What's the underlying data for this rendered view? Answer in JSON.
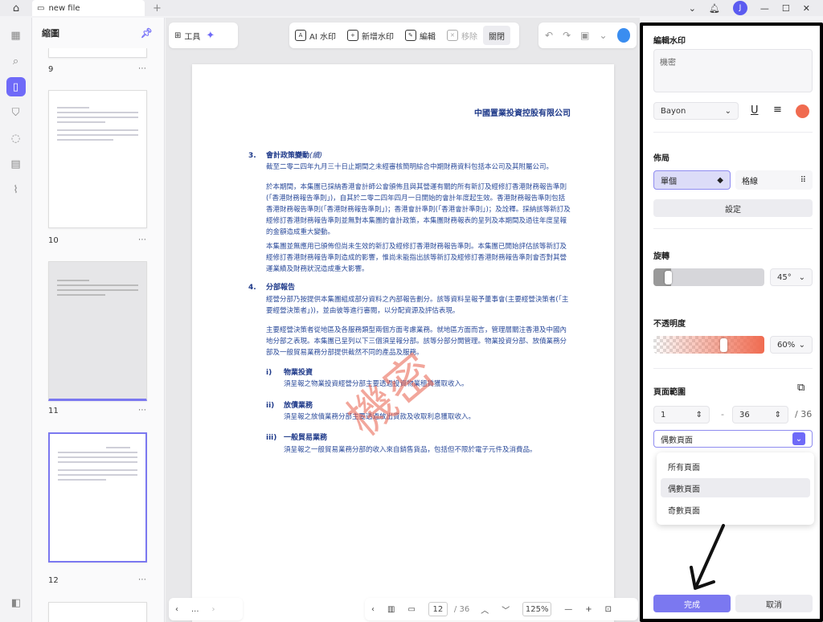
{
  "tab": {
    "title": "new file"
  },
  "left_panel": {
    "title": "縮圖"
  },
  "thumbnails": [
    {
      "number": "9",
      "top": 0
    },
    {
      "number": "10"
    },
    {
      "number": "11"
    },
    {
      "number": "12"
    }
  ],
  "toolbar": {
    "tools_label": "工具",
    "ai_watermark": "AI 水印",
    "add_watermark": "新增水印",
    "edit": "編輯",
    "remove": "移除",
    "close": "關閉"
  },
  "document": {
    "company": "中國置業投資控股有限公司",
    "section3_num": "3.",
    "section3_title": "會計政策變動",
    "section3_title_suffix": "(續)",
    "p1": "截至二零二四年九月三十日止期間之未經審核簡明綜合中期財務資料包括本公司及其附屬公司。",
    "p2": "於本期間，本集團已採納香港會計師公會頒佈且與其營運有關的所有新訂及經修訂香港財務報告準則(「香港財務報告準則」)，自其於二零二四年四月一日開始的會計年度起生效。香港財務報告準則包括香港財務報告準則(「香港財務報告準則」)；香港會計準則(「香港會計準則」)；及詮釋。採納該等新訂及經修訂香港財務報告準則並無對本集團的會計政策，本集團財務報表的呈列及本期間及過往年度呈報的金額造成重大變動。",
    "p3": "本集團並無應用已頒佈但尚未生效的新訂及經修訂香港財務報告準則。本集團已開始評估該等新訂及經修訂香港財務報告準則造成的影響，惟尚未能指出該等新訂及經修訂香港財務報告準則會否對其營運業績及財務狀況造成重大影響。",
    "section4_num": "4.",
    "section4_title": "分部報告",
    "p4": "經營分部乃按提供本集團組成部分資料之內部報告劃分。該等資料呈報予董事會(主要經營決策者(「主要經營決策者」))，並由彼等進行審閱，以分配資源及評估表現。",
    "p5": "主要經營決策者從地區及各服務類型兩個方面考慮業務。就地區方面而言，管理層關注香港及中國內地分部之表現。本集團已呈列以下三個須呈報分部。該等分部分開管理。物業投資分部、放債業務分部及一般貿易業務分部提供截然不同的產品及服務。",
    "sub1_num": "i)",
    "sub1_title": "物業投資",
    "sub1_text": "須呈報之物業投資經營分部主要透過投資物業租賃獲取收入。",
    "sub2_num": "ii)",
    "sub2_title": "放債業務",
    "sub2_text": "須呈報之放債業務分部主要透過放出貸款及收取利息獲取收入。",
    "sub3_num": "iii)",
    "sub3_title": "一般貿易業務",
    "sub3_text": "須呈報之一般貿易業務分部的收入來自銷售貨品，包括但不限於電子元件及消費品。",
    "watermark": "機密"
  },
  "bottombar": {
    "page_current": "12",
    "page_total": "/ 36",
    "zoom": "125%",
    "more": "..."
  },
  "right_panel": {
    "title": "編輯水印",
    "text_value": "機密",
    "font": "Bayon",
    "color": "#f06b50",
    "layout_label": "佈局",
    "layout_single": "單個",
    "layout_tile": "格線",
    "settings_button": "設定",
    "rotation_label": "旋轉",
    "rotation_value": "45°",
    "rotation_level": 0.1,
    "opacity_label": "不透明度",
    "opacity_value": "60%",
    "opacity_level": 0.6,
    "page_range_label": "頁面範圍",
    "range_from": "1",
    "range_dash": "-",
    "range_to": "36",
    "range_total": "/ 36",
    "range_select": "偶數頁面",
    "options": [
      "所有頁面",
      "偶數頁面",
      "奇數頁面"
    ],
    "done_button": "完成",
    "cancel_button": "取消"
  }
}
